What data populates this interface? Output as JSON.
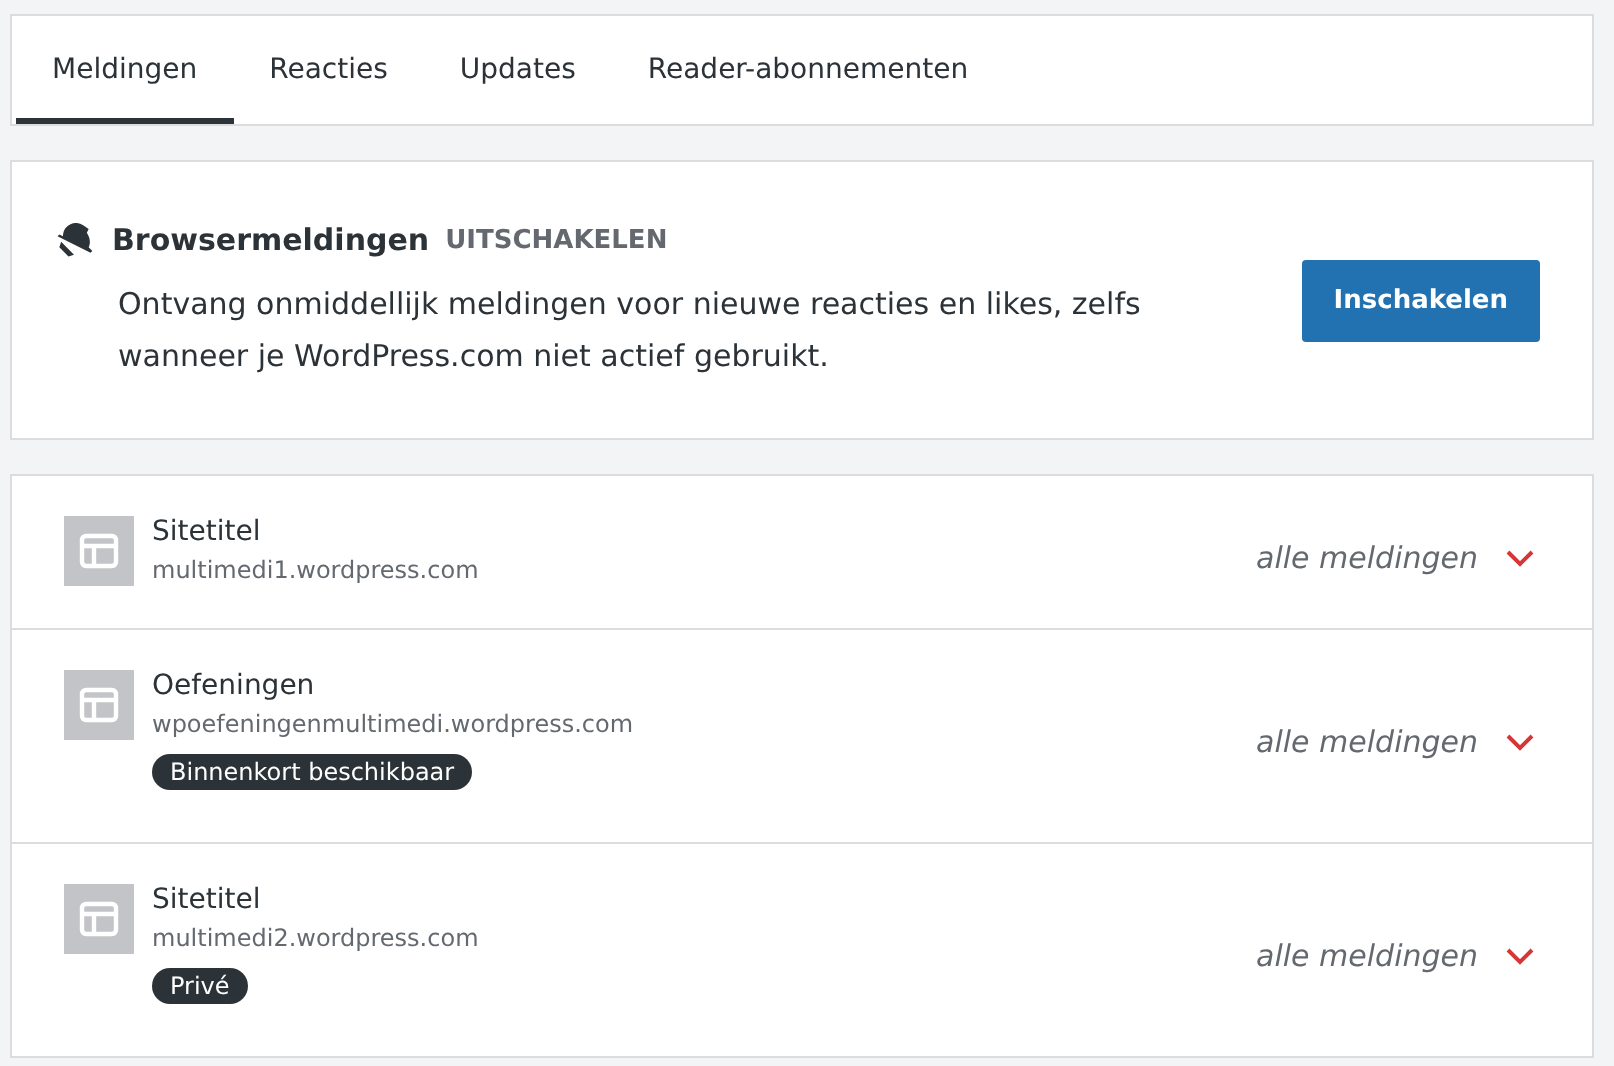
{
  "tabs": [
    {
      "label": "Meldingen",
      "selected": true
    },
    {
      "label": "Reacties",
      "selected": false
    },
    {
      "label": "Updates",
      "selected": false
    },
    {
      "label": "Reader-abonnementen",
      "selected": false
    }
  ],
  "browser_notifications": {
    "title": "Browsermeldingen",
    "toggle_link": "UITSCHAKELEN",
    "description": "Ontvang onmiddellijk meldingen voor nieuwe reacties en likes, zelfs wanneer je WordPress.com niet actief gebruikt.",
    "button": "Inschakelen"
  },
  "sites": [
    {
      "title": "Sitetitel",
      "url": "multimedi1.wordpress.com",
      "setting": "alle meldingen"
    },
    {
      "title": "Oefeningen",
      "url": "wpoefeningenmultimedi.wordpress.com",
      "badge": "Binnenkort beschikbaar",
      "setting": "alle meldingen"
    },
    {
      "title": "Sitetitel",
      "url": "multimedi2.wordpress.com",
      "badge": "Privé",
      "setting": "alle meldingen"
    }
  ]
}
